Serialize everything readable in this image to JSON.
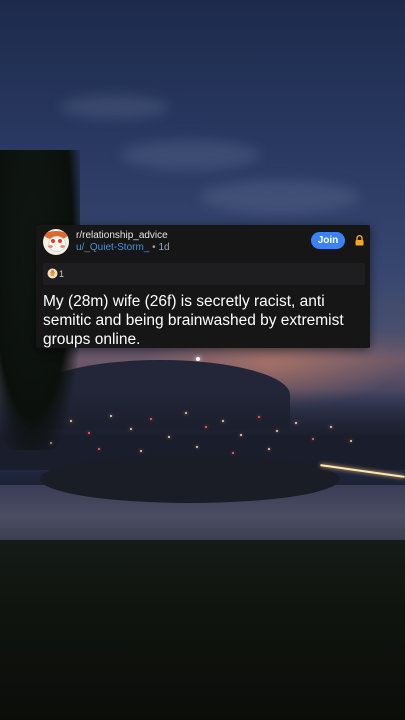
{
  "post": {
    "subreddit": "r/relationship_advice",
    "username": "u/_Quiet-Storm_",
    "separator": "•",
    "age": "1d",
    "join_label": "Join",
    "award_count": "1",
    "title": "My (28m) wife (26f) is secretly racist, anti semitic and being brainwashed by extremist groups online."
  },
  "colors": {
    "card_bg": "#161617",
    "join_bg": "#3b82f6",
    "username": "#4a90e2",
    "lock": "#f5a623"
  },
  "icons": {
    "avatar": "snoo-avatar",
    "lock": "lock-icon",
    "award": "award-icon"
  }
}
